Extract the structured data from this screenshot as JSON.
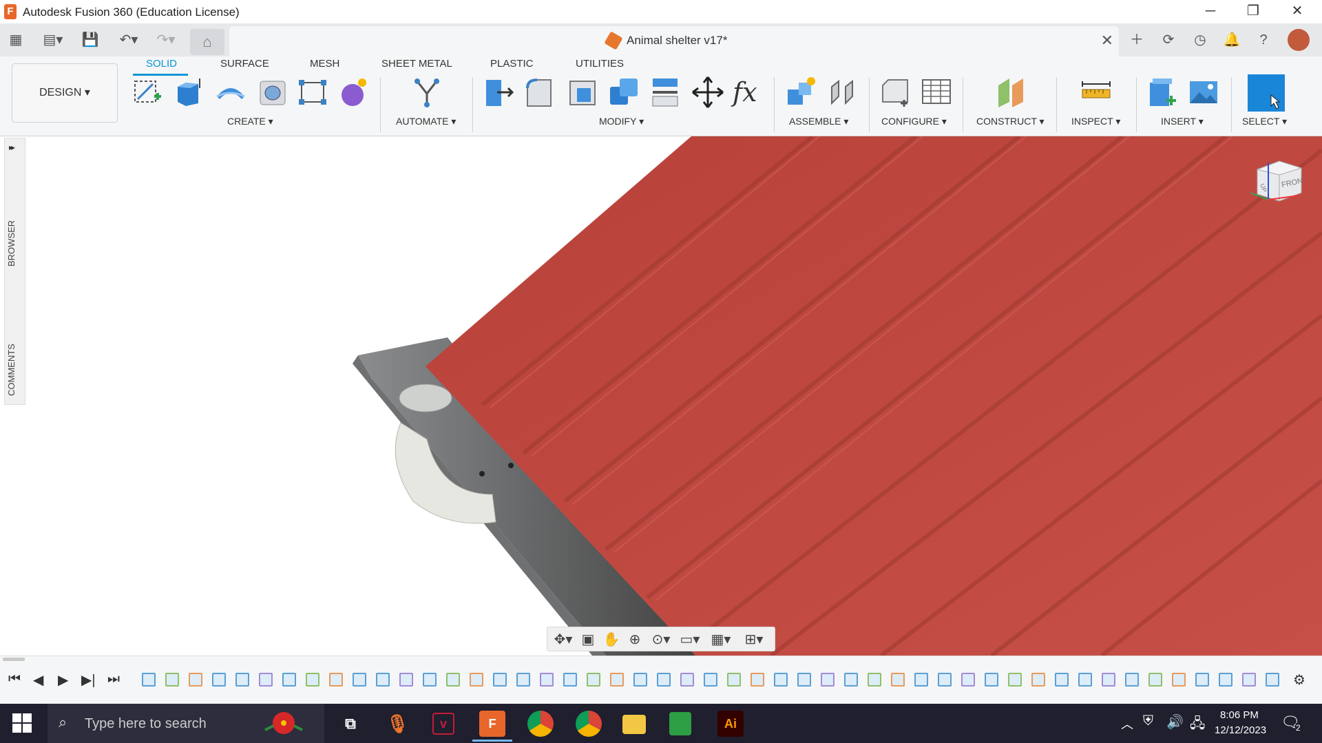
{
  "window": {
    "title": "Autodesk Fusion 360 (Education License)",
    "logo_letter": "F"
  },
  "document_tab": {
    "title": "Animal shelter v17*",
    "close_glyph": "✕"
  },
  "ribbon": {
    "workspace": "DESIGN ▾",
    "tabs": [
      "SOLID",
      "SURFACE",
      "MESH",
      "SHEET METAL",
      "PLASTIC",
      "UTILITIES"
    ],
    "active_tab": "SOLID",
    "groups": [
      "CREATE ▾",
      "AUTOMATE ▾",
      "MODIFY ▾",
      "ASSEMBLE ▾",
      "CONFIGURE ▾",
      "CONSTRUCT ▾",
      "INSPECT ▾",
      "INSERT ▾",
      "SELECT ▾"
    ]
  },
  "side_panel": {
    "browser_label": "BROWSER",
    "comments_label": "COMMENTS",
    "expand_glyph": "▸▸"
  },
  "viewcube": {
    "face_label": "FRONT",
    "top_label": "UP"
  },
  "taskbar": {
    "search_placeholder": "Type here to search",
    "time": "8:06 PM",
    "date": "12/12/2023",
    "notification_count": "2"
  },
  "colors": {
    "accent": "#0696d7",
    "roof_red": "#b8423a",
    "fusion_orange": "#e8662a"
  }
}
